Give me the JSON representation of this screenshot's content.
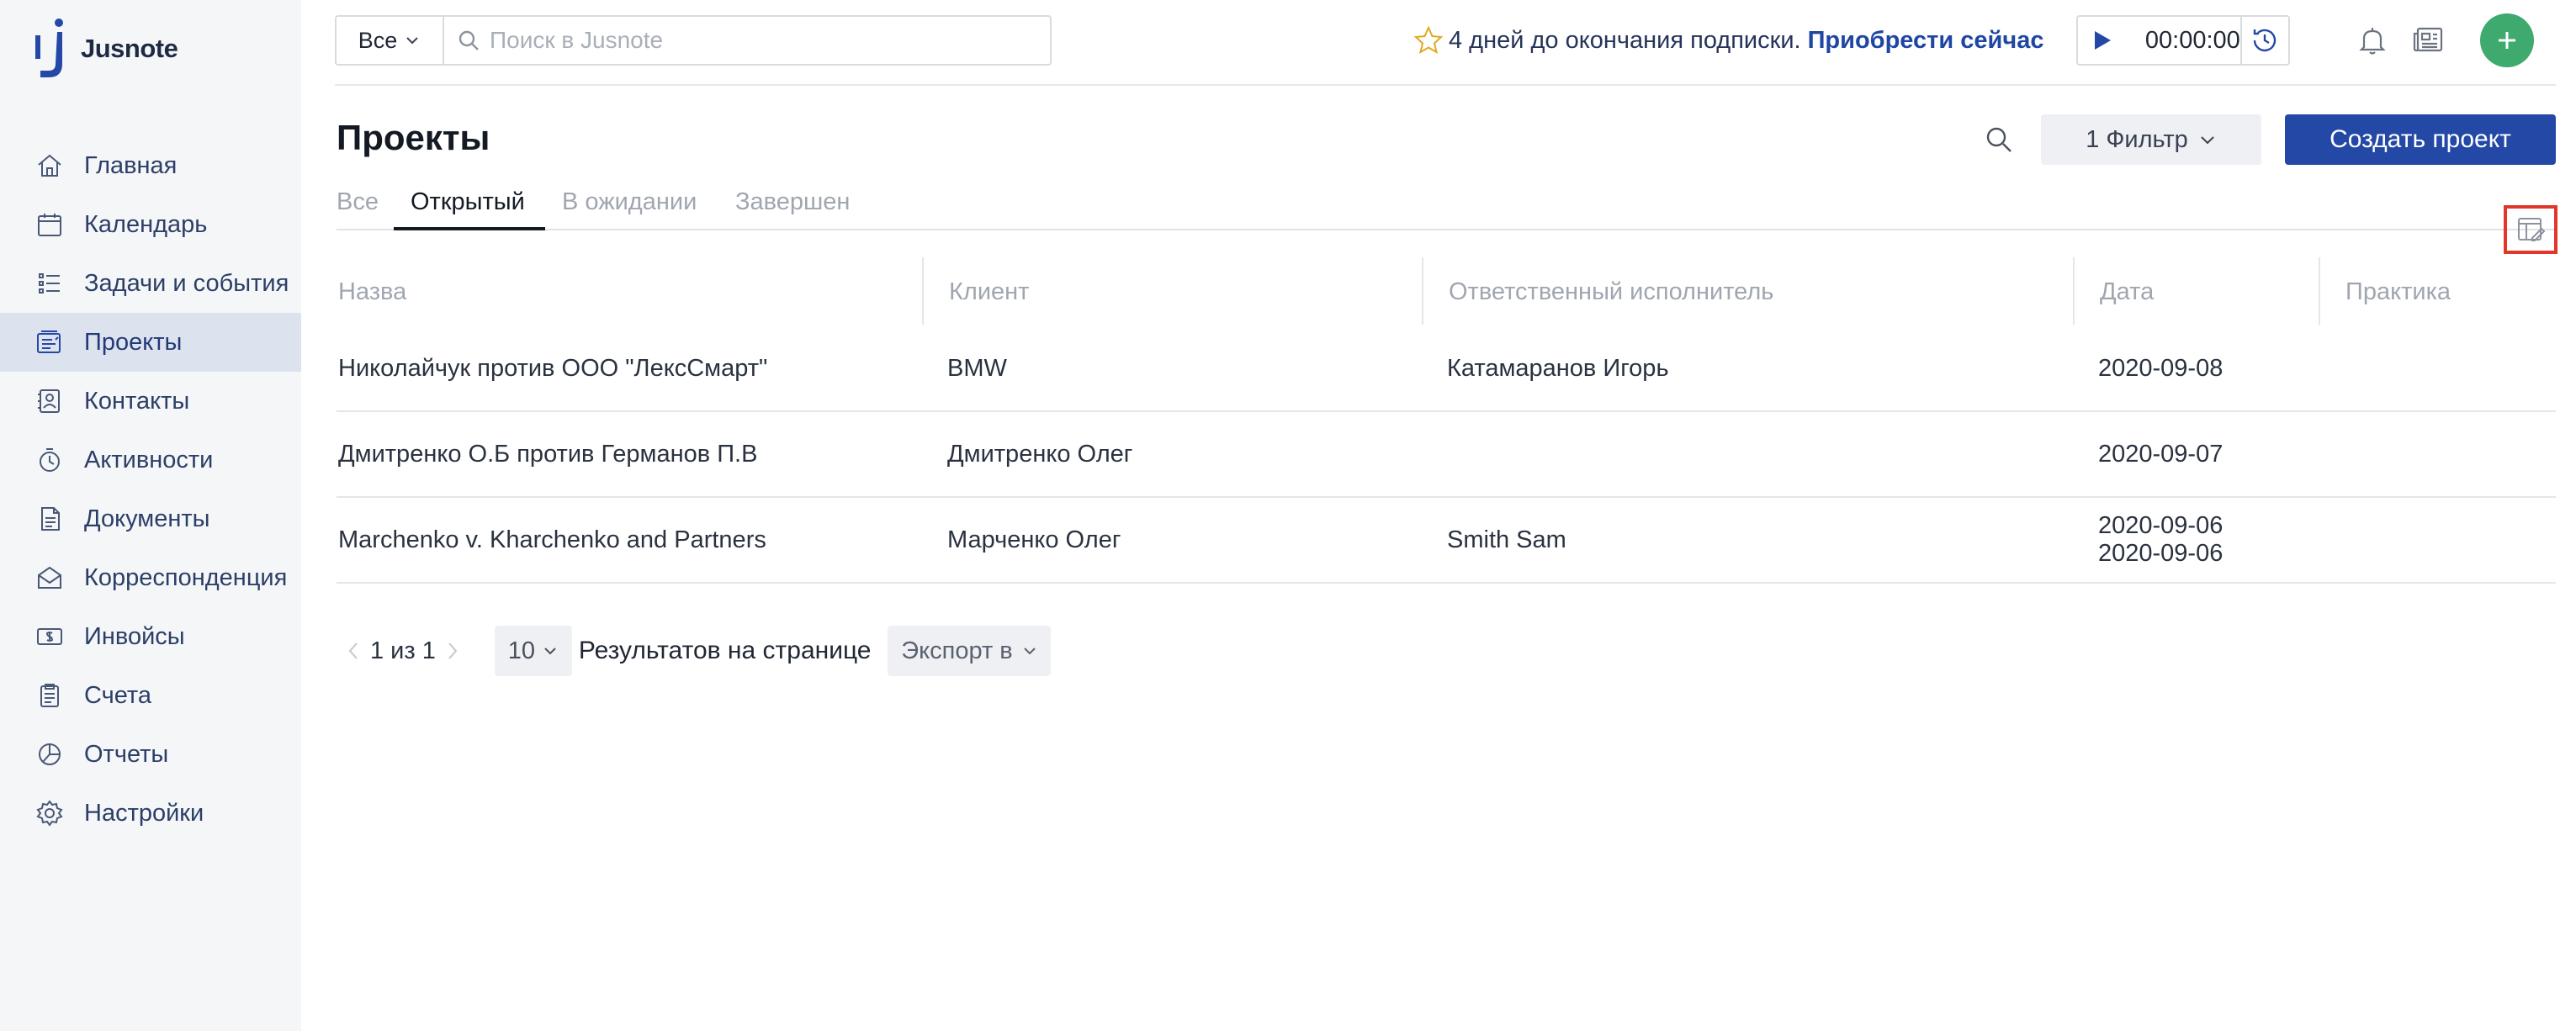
{
  "app": {
    "name": "Jusnote"
  },
  "sidebar": {
    "items": [
      {
        "label": "Главная",
        "icon": "home-icon",
        "active": false
      },
      {
        "label": "Календарь",
        "icon": "calendar-icon",
        "active": false
      },
      {
        "label": "Задачи и события",
        "icon": "tasks-icon",
        "active": false
      },
      {
        "label": "Проекты",
        "icon": "projects-icon",
        "active": true
      },
      {
        "label": "Контакты",
        "icon": "contacts-icon",
        "active": false
      },
      {
        "label": "Активности",
        "icon": "activity-icon",
        "active": false
      },
      {
        "label": "Документы",
        "icon": "documents-icon",
        "active": false
      },
      {
        "label": "Корреспонденция",
        "icon": "correspondence-icon",
        "active": false
      },
      {
        "label": "Инвойсы",
        "icon": "invoices-icon",
        "active": false
      },
      {
        "label": "Счета",
        "icon": "accounts-icon",
        "active": false
      },
      {
        "label": "Отчеты",
        "icon": "reports-icon",
        "active": false
      },
      {
        "label": "Настройки",
        "icon": "settings-icon",
        "active": false
      }
    ]
  },
  "topbar": {
    "search_scope": "Все",
    "search_placeholder": "Поиск в Jusnote",
    "promo_text": "4 дней до окончания подписки.",
    "promo_link": "Приобрести сейчас",
    "timer": "00:00:00"
  },
  "page": {
    "title": "Проекты",
    "filter_label": "1 Фильтр",
    "create_label": "Создать проект"
  },
  "tabs": [
    {
      "label": "Все",
      "active": false
    },
    {
      "label": "Открытый",
      "active": true
    },
    {
      "label": "В ожидании",
      "active": false
    },
    {
      "label": "Завершен",
      "active": false
    }
  ],
  "table": {
    "columns": [
      "Назва",
      "Клиент",
      "Ответственный исполнитель",
      "Дата",
      "Практика"
    ],
    "rows": [
      {
        "name": "Николайчук против ООО \"ЛексСмарт\"",
        "client": "BMW",
        "responsible": "Катамаранов Игорь",
        "dates": [
          "2020-09-08"
        ],
        "practice": ""
      },
      {
        "name": "Дмитренко О.Б против Германов П.В",
        "client": "Дмитренко Олег",
        "responsible": "",
        "dates": [
          "2020-09-07"
        ],
        "practice": ""
      },
      {
        "name": "Marchenko v. Kharchenko and Partners",
        "client": "Марченко Олег",
        "responsible": "Smith Sam",
        "dates": [
          "2020-09-06",
          "2020-09-06"
        ],
        "practice": ""
      }
    ]
  },
  "pagination": {
    "page_info": "1 из 1",
    "per_page": "10",
    "per_page_label": "Результатов на странице",
    "export_label": "Экспорт в"
  },
  "colors": {
    "primary": "#2348a6",
    "sidebar_bg": "#f5f6f8",
    "sidebar_active": "#dde3ee",
    "fab": "#3faa6e",
    "highlight_border": "#e0372a",
    "star": "#e0a920"
  }
}
